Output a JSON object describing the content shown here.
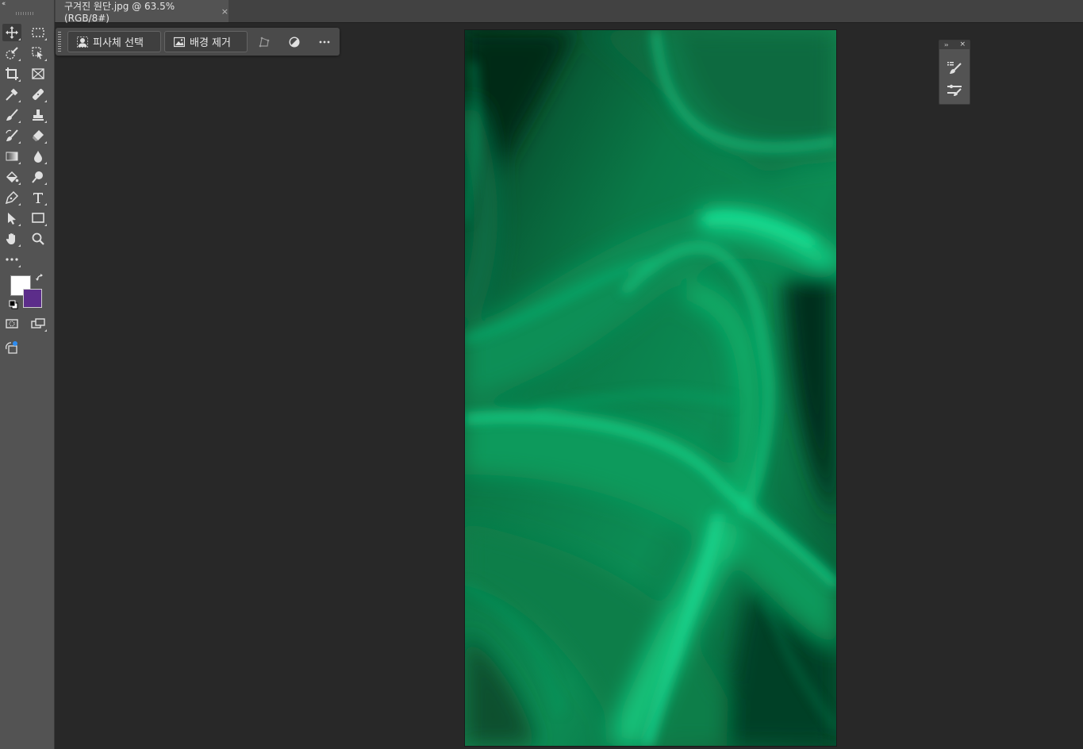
{
  "document": {
    "tab_title": "구겨진 원단.jpg @ 63.5% (RGB/8#)",
    "close_glyph": "×"
  },
  "contextual_taskbar": {
    "select_subject_label": "피사체 선택",
    "remove_background_label": "배경 제거",
    "icons": [
      "transform-icon",
      "adjust-icon",
      "more-icon"
    ]
  },
  "toolbar": {
    "collapse_glyph": "‹‹",
    "tools": [
      "move-icon",
      "marquee-icon",
      "quick-selection-icon",
      "object-selection-icon",
      "crop-icon",
      "frame-icon",
      "eyedropper-icon",
      "healing-brush-icon",
      "brush-icon",
      "clone-stamp-icon",
      "history-brush-icon",
      "eraser-icon",
      "gradient-icon",
      "blur-icon",
      "paint-bucket-icon",
      "dodge-icon",
      "pen-icon",
      "type-icon",
      "path-selection-icon",
      "rectangle-icon",
      "hand-icon",
      "zoom-icon",
      "edit-toolbar-icon"
    ],
    "foreground_color": "#ffffff",
    "background_color": "#5c2d8a",
    "mode_icons": [
      "quick-mask-icon",
      "screen-mode-icon",
      "generative-fill-icon"
    ]
  },
  "floating_panel": {
    "expand_glyph": "››",
    "close_glyph": "×",
    "buttons": [
      "brush-settings-icon",
      "brush-presets-icon"
    ]
  },
  "canvas": {
    "image": "green-satin-fabric",
    "accent": "#0fb872"
  }
}
